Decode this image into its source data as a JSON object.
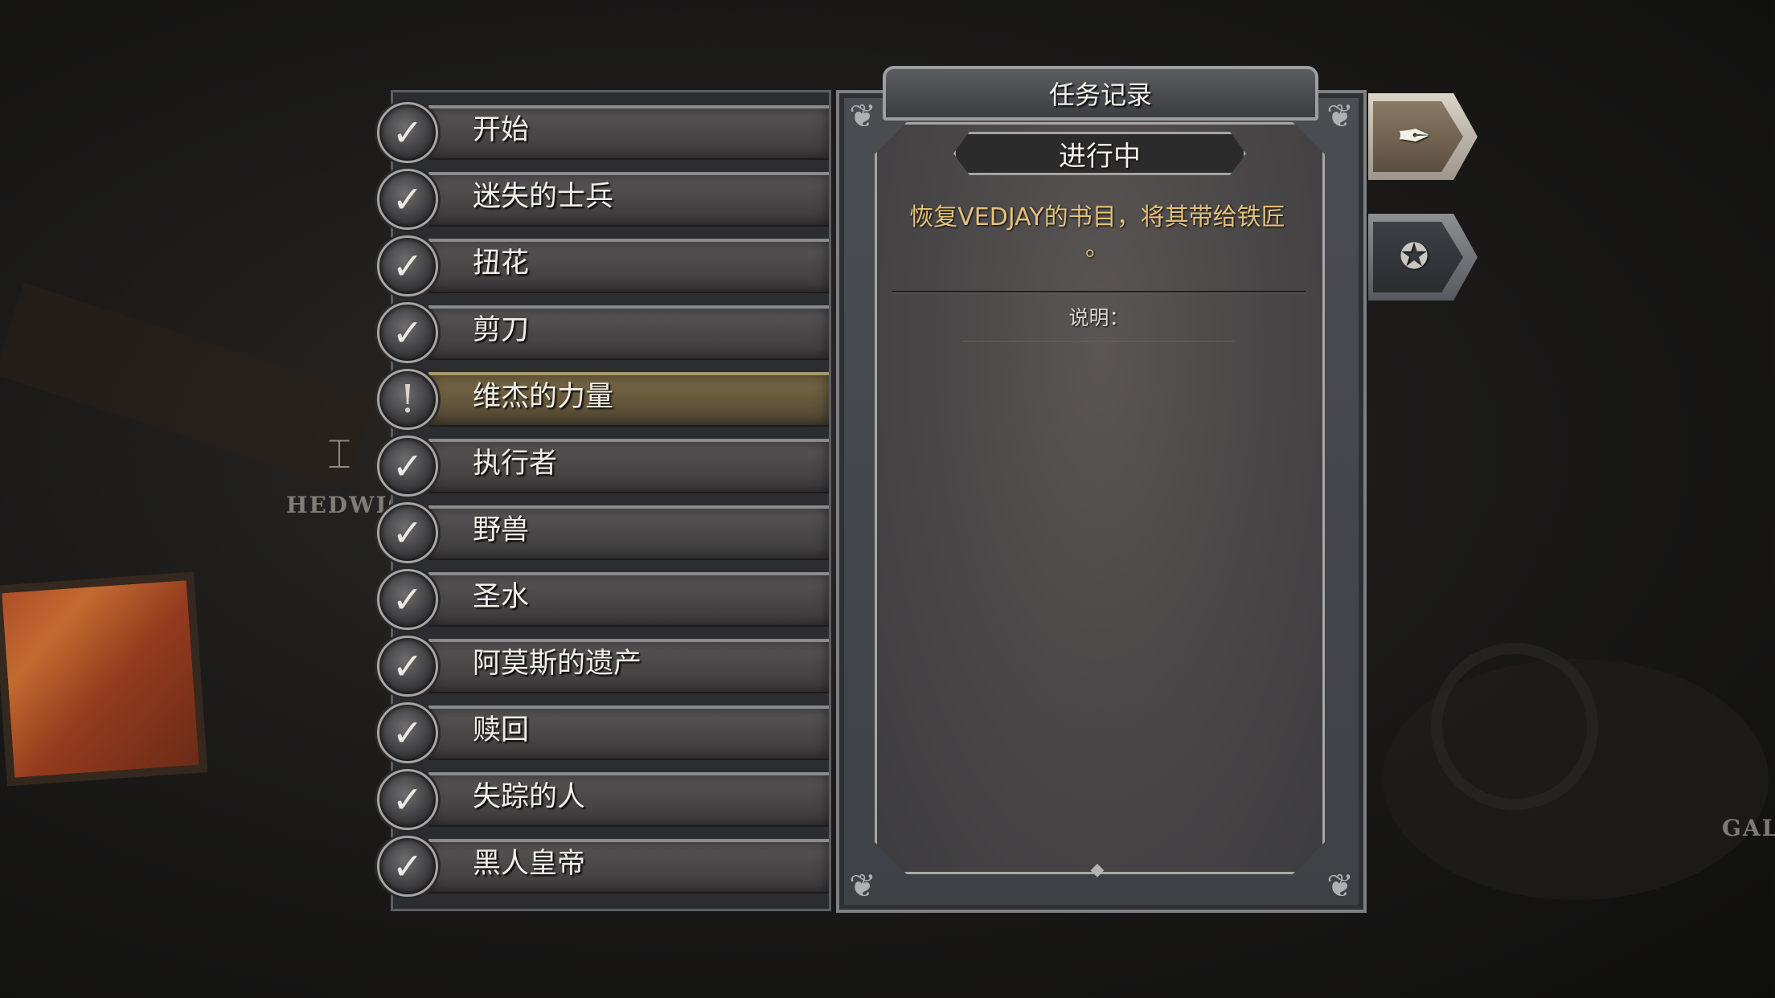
{
  "world": {
    "labels": {
      "hedwig": "HEDWIG",
      "gal": "GAL"
    },
    "icons": {
      "hedwig": "anvil-icon"
    }
  },
  "quest_list": {
    "items": [
      {
        "label": "开始",
        "status": "completed",
        "icon": "checkmark-icon",
        "glyph": "✓"
      },
      {
        "label": "迷失的士兵",
        "status": "completed",
        "icon": "checkmark-icon",
        "glyph": "✓"
      },
      {
        "label": "扭花",
        "status": "completed",
        "icon": "checkmark-icon",
        "glyph": "✓"
      },
      {
        "label": "剪刀",
        "status": "completed",
        "icon": "checkmark-icon",
        "glyph": "✓"
      },
      {
        "label": "维杰的力量",
        "status": "active",
        "icon": "exclamation-icon",
        "glyph": "!"
      },
      {
        "label": "执行者",
        "status": "completed",
        "icon": "checkmark-icon",
        "glyph": "✓"
      },
      {
        "label": "野兽",
        "status": "completed",
        "icon": "checkmark-icon",
        "glyph": "✓"
      },
      {
        "label": "圣水",
        "status": "completed",
        "icon": "checkmark-icon",
        "glyph": "✓"
      },
      {
        "label": "阿莫斯的遗产",
        "status": "completed",
        "icon": "checkmark-icon",
        "glyph": "✓"
      },
      {
        "label": "赎回",
        "status": "completed",
        "icon": "checkmark-icon",
        "glyph": "✓"
      },
      {
        "label": "失踪的人",
        "status": "completed",
        "icon": "checkmark-icon",
        "glyph": "✓"
      },
      {
        "label": "黑人皇帝",
        "status": "completed",
        "icon": "checkmark-icon",
        "glyph": "✓"
      }
    ]
  },
  "journal": {
    "title": "任务记录",
    "status": "进行中",
    "objective_line1": "恢复VEDJAY的书目，将其带给铁匠",
    "objective_line2": "。",
    "description_label": "说明：",
    "colors": {
      "objective": "#e3c27a",
      "active_quest": "#7d6c49"
    }
  },
  "side_tabs": [
    {
      "name": "quest-journal-tab",
      "icon": "quill-icon",
      "glyph": "✒"
    },
    {
      "name": "achievements-tab",
      "icon": "laurel-star-icon",
      "glyph": "✪"
    }
  ]
}
